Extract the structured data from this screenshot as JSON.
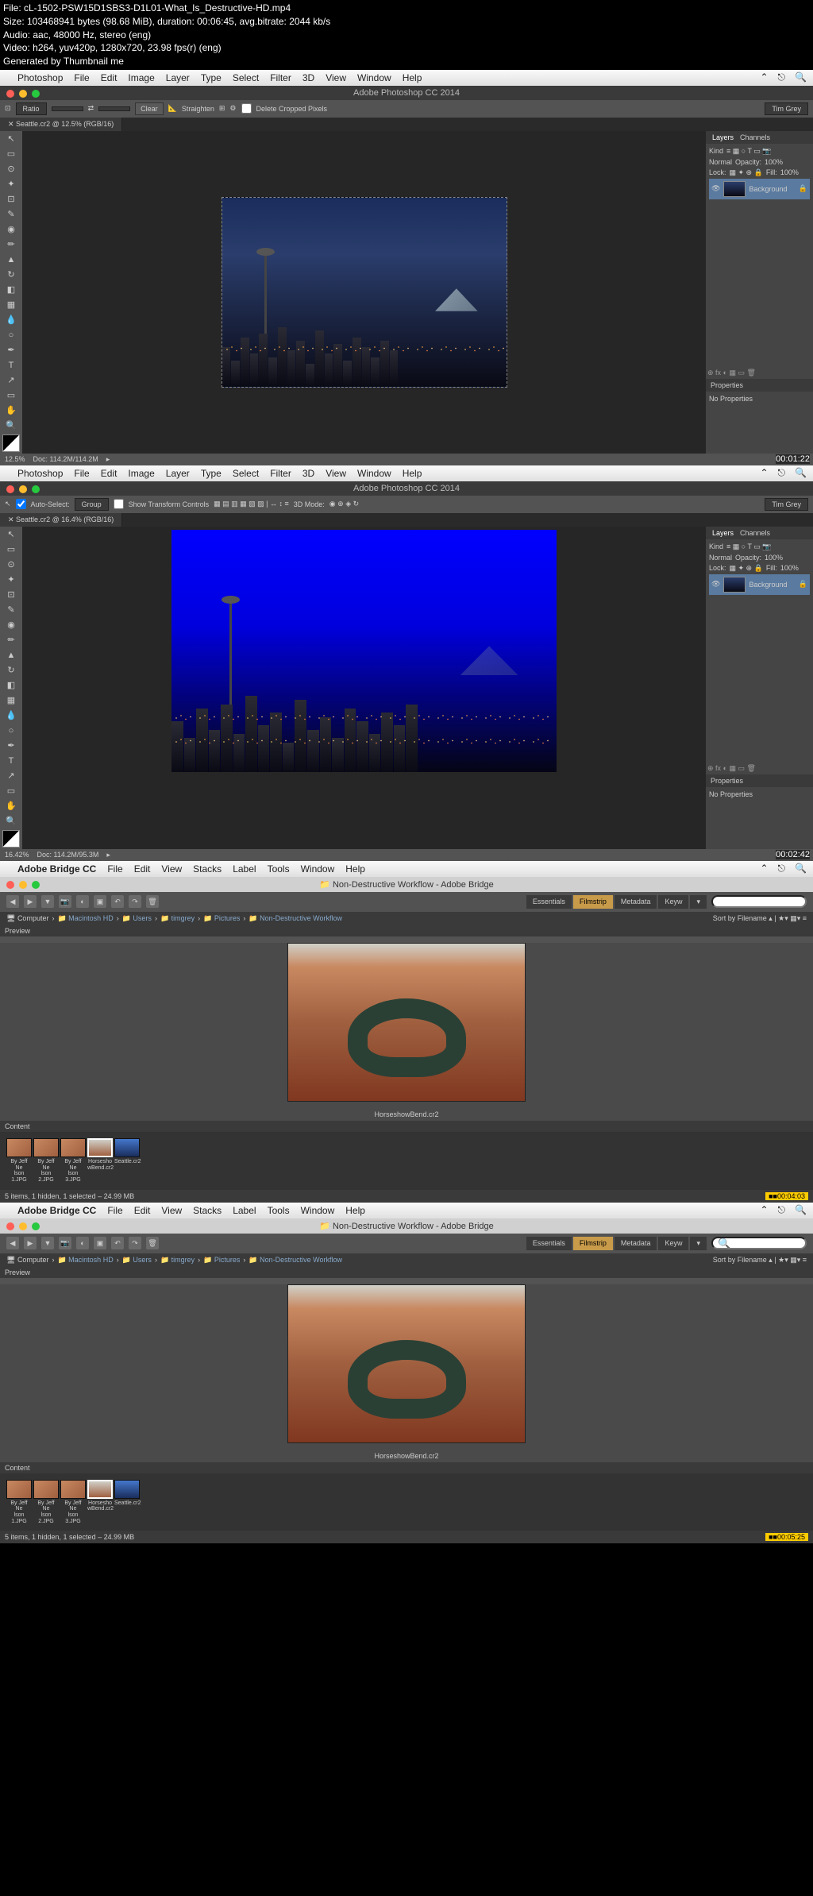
{
  "meta": {
    "file": "File: cL-1502-PSW15D1SBS3-D1L01-What_Is_Destructive-HD.mp4",
    "size": "Size: 103468941 bytes (98.68 MiB), duration: 00:06:45, avg.bitrate: 2044 kb/s",
    "audio": "Audio: aac, 48000 Hz, stereo (eng)",
    "video": "Video: h264, yuv420p, 1280x720, 23.98 fps(r) (eng)",
    "generated": "Generated by Thumbnail me"
  },
  "ps_menu": {
    "items": [
      "Photoshop",
      "File",
      "Edit",
      "Image",
      "Layer",
      "Type",
      "Select",
      "Filter",
      "3D",
      "View",
      "Window",
      "Help"
    ]
  },
  "ps1": {
    "title": "Adobe Photoshop CC 2014",
    "opt_ratio": "Ratio",
    "opt_clear": "Clear",
    "opt_straighten": "Straighten",
    "opt_delete": "Delete Cropped Pixels",
    "user": "Tim Grey",
    "tab": "Seattle.cr2 @ 12.5% (RGB/16)",
    "zoom": "12.5%",
    "doc": "Doc: 114.2M/114.2M",
    "timestamp": "00:01:22"
  },
  "ps2": {
    "title": "Adobe Photoshop CC 2014",
    "opt_auto": "Auto-Select:",
    "opt_group": "Group",
    "opt_show": "Show Transform Controls",
    "opt_3d": "3D Mode:",
    "user": "Tim Grey",
    "tab": "Seattle.cr2 @ 16.4% (RGB/16)",
    "zoom": "16.42%",
    "doc": "Doc: 114.2M/95.3M",
    "timestamp": "00:02:42"
  },
  "layers": {
    "tab1": "Layers",
    "tab2": "Channels",
    "kind": "Kind",
    "normal": "Normal",
    "opacity": "Opacity:",
    "opval": "100%",
    "lock": "Lock:",
    "fill": "Fill:",
    "fillval": "100%",
    "bg": "Background"
  },
  "props": {
    "title": "Properties",
    "none": "No Properties"
  },
  "br_menu": {
    "app": "Adobe Bridge CC",
    "items": [
      "File",
      "Edit",
      "View",
      "Stacks",
      "Label",
      "Tools",
      "Window",
      "Help"
    ]
  },
  "br": {
    "wtitle": "Non-Destructive Workflow - Adobe Bridge",
    "tabs": {
      "essentials": "Essentials",
      "filmstrip": "Filmstrip",
      "metadata": "Metadata",
      "keyw": "Keyw"
    },
    "search": "",
    "path_computer": "Computer",
    "path_hd": "Macintosh HD",
    "path_users": "Users",
    "path_user": "timgrey",
    "path_pics": "Pictures",
    "path_folder": "Non-Destructive Workflow",
    "sort": "Sort by Filename",
    "preview_label": "Preview",
    "caption": "HorseshowBend.cr2",
    "content_label": "Content",
    "status": "5 items, 1 hidden, 1 selected – 24.99 MB",
    "ts1": "00:04:03",
    "ts2": "00:05:25"
  },
  "thumbs": [
    {
      "l1": "By Jeff Ne",
      "l2": "lson 1.JPG"
    },
    {
      "l1": "By Jeff Ne",
      "l2": "lson 2.JPG"
    },
    {
      "l1": "By Jeff Ne",
      "l2": "lson 3.JPG"
    },
    {
      "l1": "Horsesho",
      "l2": "wBend.cr2"
    },
    {
      "l1": "Seattle.cr2",
      "l2": ""
    }
  ]
}
